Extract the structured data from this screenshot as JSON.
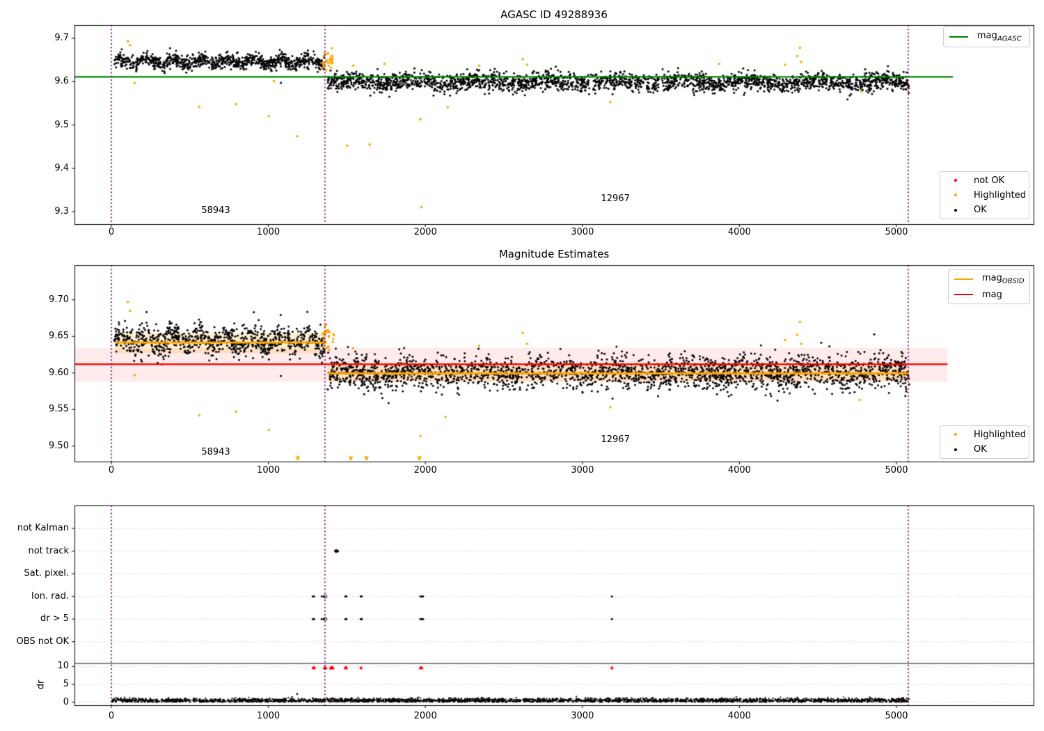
{
  "colors": {
    "ok": "#000000",
    "highlighted": "#FFA500",
    "not_ok": "#FF0000",
    "mag_agasc_line": "#008000",
    "mag_line": "#FF0000",
    "obsid_line": "#FFA500",
    "band_red": "rgba(255,0,0,0.08)",
    "band_orange": "rgba(255,165,0,0.18)",
    "vline": "#800080",
    "grid": "#bbbbbb",
    "spine": "#000000"
  },
  "chart_data": [
    {
      "type": "scatter",
      "title": "AGASC ID 49288936",
      "xlim": [
        -235,
        5875
      ],
      "ylim": [
        9.271,
        9.7305
      ],
      "xticks": [
        0,
        1000,
        2000,
        3000,
        4000,
        5000
      ],
      "xtick_labels": [
        "0",
        "1000",
        "2000",
        "3000",
        "4000",
        "5000"
      ],
      "yticks": [
        9.3,
        9.4,
        9.5,
        9.6,
        9.7
      ],
      "ytick_labels": [
        "9.3",
        "9.4",
        "9.5",
        "9.6",
        "9.7"
      ],
      "grid": false,
      "vlines": [
        0,
        1360,
        5075
      ],
      "agasc_mag_line": {
        "y": 9.611,
        "x_start": -235,
        "x_end": 5360
      },
      "legend_line": {
        "label": "mag",
        "sub": "AGASC"
      },
      "legend_status": {
        "not_ok": "not OK",
        "highlighted": "Highlighted",
        "ok": "OK"
      },
      "annotations": [
        {
          "text": "58943",
          "x": 665,
          "y": 9.302
        },
        {
          "text": "12967",
          "x": 3210,
          "y": 9.329
        }
      ],
      "ok_series": {
        "segments": [
          {
            "x0": 15,
            "x1": 1360,
            "n": 860,
            "mean": 9.6465,
            "sd": 0.0085,
            "wave_amp": 0.0065,
            "wave_period": 170
          },
          {
            "x0": 1378,
            "x1": 5082,
            "n": 2300,
            "mean": 9.5985,
            "sd": 0.0105,
            "wave_amp": 0.004,
            "wave_period": 430
          }
        ],
        "extra_points": [
          [
            3192,
            9.571
          ],
          [
            2052,
            9.568
          ],
          [
            1080,
            9.597
          ]
        ]
      },
      "highlighted_series": {
        "cluster": {
          "x0": 1344,
          "x1": 1410,
          "n": 30,
          "mean": 9.649,
          "sd": 0.012
        },
        "points": [
          [
            105,
            9.693
          ],
          [
            118,
            9.684
          ],
          [
            148,
            9.597
          ],
          [
            560,
            9.542
          ],
          [
            795,
            9.548
          ],
          [
            1002,
            9.52
          ],
          [
            1035,
            9.601
          ],
          [
            1183,
            9.474
          ],
          [
            1502,
            9.452
          ],
          [
            1645,
            9.455
          ],
          [
            1540,
            9.637
          ],
          [
            1740,
            9.641
          ],
          [
            1968,
            9.513
          ],
          [
            1975,
            9.31
          ],
          [
            2142,
            9.541
          ],
          [
            2342,
            9.637
          ],
          [
            2620,
            9.652
          ],
          [
            2648,
            9.639
          ],
          [
            3178,
            9.553
          ],
          [
            3872,
            9.641
          ],
          [
            4290,
            9.639
          ],
          [
            4368,
            9.659
          ],
          [
            4385,
            9.678
          ],
          [
            4393,
            9.645
          ],
          [
            4778,
            9.577
          ]
        ]
      }
    },
    {
      "type": "scatter",
      "title": "Magnitude Estimates",
      "xlim": [
        -235,
        5875
      ],
      "ylim": [
        9.4788,
        9.7473
      ],
      "xticks": [
        0,
        1000,
        2000,
        3000,
        4000,
        5000
      ],
      "xtick_labels": [
        "0",
        "1000",
        "2000",
        "3000",
        "4000",
        "5000"
      ],
      "yticks": [
        9.5,
        9.55,
        9.6,
        9.65,
        9.7
      ],
      "ytick_labels": [
        "9.50",
        "9.55",
        "9.60",
        "9.65",
        "9.70"
      ],
      "grid": false,
      "vlines": [
        0,
        1360,
        5075
      ],
      "mag_line": {
        "y": 9.612,
        "band": [
          9.588,
          9.6345
        ],
        "x_start": -235,
        "x_end": 5325
      },
      "obsid_lines": [
        {
          "x0": 25,
          "x1": 1362,
          "y": 9.6416,
          "band": [
            9.627,
            9.6545
          ]
        },
        {
          "x0": 1378,
          "x1": 5078,
          "y": 9.5995,
          "band": [
            9.5885,
            9.6115
          ]
        }
      ],
      "clip_markers_x": [
        1187,
        1525,
        1625,
        1962
      ],
      "legend_lines": {
        "obsid_label": "mag",
        "obsid_sub": "OBSID",
        "mag_label": "mag"
      },
      "legend_status": {
        "highlighted": "Highlighted",
        "ok": "OK"
      },
      "annotations": [
        {
          "text": "58943",
          "x": 665,
          "y": 9.491
        },
        {
          "text": "12967",
          "x": 3210,
          "y": 9.508
        }
      ],
      "ok_series": {
        "segments": [
          {
            "x0": 15,
            "x1": 1360,
            "n": 860,
            "mean": 9.6445,
            "sd": 0.01,
            "wave_amp": 0.007,
            "wave_period": 170
          },
          {
            "x0": 1378,
            "x1": 5082,
            "n": 2300,
            "mean": 9.6005,
            "sd": 0.0115,
            "wave_amp": 0.004,
            "wave_period": 430
          }
        ],
        "extra_points": [
          [
            3192,
            9.565
          ],
          [
            1080,
            9.596
          ]
        ]
      },
      "highlighted_series": {
        "cluster": {
          "x0": 1344,
          "x1": 1420,
          "n": 28,
          "mean": 9.651,
          "sd": 0.012
        },
        "points": [
          [
            105,
            9.697
          ],
          [
            118,
            9.685
          ],
          [
            148,
            9.597
          ],
          [
            560,
            9.542
          ],
          [
            795,
            9.547
          ],
          [
            1002,
            9.522
          ],
          [
            1540,
            9.634
          ],
          [
            1968,
            9.514
          ],
          [
            2128,
            9.54
          ],
          [
            2342,
            9.637
          ],
          [
            2620,
            9.655
          ],
          [
            2648,
            9.64
          ],
          [
            3178,
            9.553
          ],
          [
            4290,
            9.645
          ],
          [
            4368,
            9.652
          ],
          [
            4385,
            9.67
          ],
          [
            4393,
            9.64
          ],
          [
            4765,
            9.563
          ]
        ]
      }
    },
    {
      "type": "scatter",
      "title": "",
      "categories": [
        "not Kalman",
        "not track",
        "Sat. pixel.",
        "Ion. rad.",
        "dr > 5",
        "OBS not OK"
      ],
      "dr_axis": {
        "label": "dr",
        "ticks": [
          10,
          5,
          0
        ],
        "tick_labels": [
          "10",
          "5",
          "0"
        ],
        "clip_value": 10
      },
      "xticks": [
        0,
        1000,
        2000,
        3000,
        4000,
        5000
      ],
      "xtick_labels": [
        "0",
        "1000",
        "2000",
        "3000",
        "4000",
        "5000"
      ],
      "grid": true,
      "vlines": [
        0,
        1360,
        5075
      ],
      "flags": {
        "not Kalman": {
          "points": [],
          "open": []
        },
        "not track": {
          "points": [
            1426,
            1431,
            1437,
            1443
          ],
          "open": [
            1433
          ]
        },
        "Sat. pixel.": {
          "points": [],
          "open": []
        },
        "Ion. rad.": {
          "points": [
            1283,
            1291,
            1340,
            1352,
            1490,
            1497,
            1588,
            1595,
            1968,
            1977,
            1985,
            3188
          ],
          "open": [
            1363
          ]
        },
        "dr > 5": {
          "points": [
            1283,
            1291,
            1340,
            1352,
            1490,
            1497,
            1588,
            1595,
            1968,
            1977,
            1985,
            3188
          ],
          "open": [
            1363
          ]
        },
        "OBS not OK": {
          "points": [],
          "open": []
        }
      },
      "dr_clipped_x": [
        1285,
        1293,
        1357,
        1366,
        1396,
        1401,
        1406,
        1411,
        1490,
        1497,
        1590,
        1968,
        1977,
        3188
      ],
      "dr_series": {
        "x0": 3,
        "x1": 5080,
        "n": 3000,
        "mean": 0.5,
        "sd": 0.3,
        "extra_points": [
          [
            1183,
            2.3
          ],
          [
            1150,
            1.45
          ],
          [
            3020,
            1.2
          ]
        ]
      }
    }
  ]
}
